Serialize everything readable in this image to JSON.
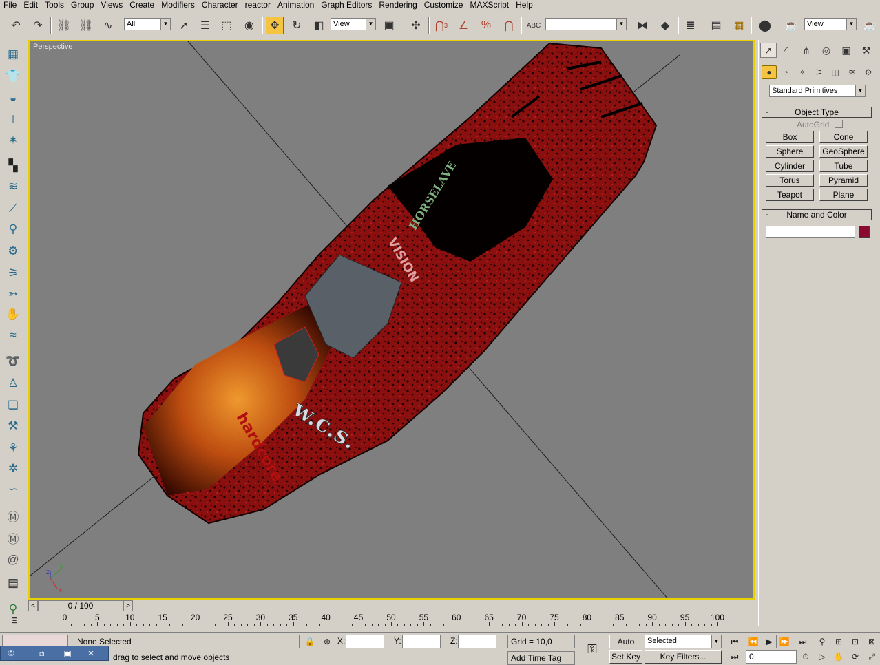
{
  "menu": [
    "File",
    "Edit",
    "Tools",
    "Group",
    "Views",
    "Create",
    "Modifiers",
    "Character",
    "reactor",
    "Animation",
    "Graph Editors",
    "Rendering",
    "Customize",
    "MAXScript",
    "Help"
  ],
  "toolbar": {
    "selection_filter": "All",
    "ref_coord_1": "View",
    "named_selection": "",
    "ref_coord_2": "View",
    "snap_label": "3",
    "percent_label": "%"
  },
  "viewport": {
    "label": "Perspective",
    "background_color": "#7f7f7f",
    "border_color": "#e8d000",
    "axis_labels": [
      "x",
      "y",
      "z"
    ],
    "car_decals": [
      "w.c.s.",
      "hardcore",
      "HORSELAVE",
      "VISION"
    ]
  },
  "command_panel": {
    "category_dropdown": "Standard Primitives",
    "object_type_title": "Object Type",
    "autogrid_label": "AutoGrid",
    "buttons": [
      "Box",
      "Cone",
      "Sphere",
      "GeoSphere",
      "Cylinder",
      "Tube",
      "Torus",
      "Pyramid",
      "Teapot",
      "Plane"
    ],
    "name_color_title": "Name and Color",
    "name_value": "",
    "object_color": "#8b0a32"
  },
  "time_slider": {
    "position_label": "0 / 100",
    "ticks": [
      "0",
      "5",
      "10",
      "15",
      "20",
      "25",
      "30",
      "35",
      "40",
      "45",
      "50",
      "55",
      "60",
      "65",
      "70",
      "75",
      "80",
      "85",
      "90",
      "95",
      "100"
    ]
  },
  "status": {
    "selection": "None Selected",
    "prompt": "drag to select and move objects",
    "x_label": "X:",
    "y_label": "Y:",
    "z_label": "Z:",
    "x_value": "",
    "y_value": "",
    "z_value": "",
    "grid": "Grid = 10,0",
    "add_time_tag": "Add Time Tag",
    "auto_key": "Auto Key",
    "set_key": "Set Key",
    "key_mode": "Selected",
    "key_filters": "Key Filters...",
    "current_frame": "0"
  }
}
